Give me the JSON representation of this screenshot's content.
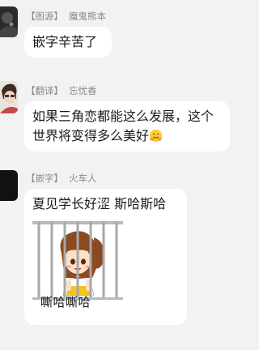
{
  "messages": [
    {
      "tag": "【图源】",
      "name": "魔鬼熊本",
      "text": "嵌字辛苦了",
      "avatar_icon": "dark-avatar-icon"
    },
    {
      "tag": "【翻译】",
      "name": "忘忧香",
      "text": "如果三角恋都能这么发展，这个世界将变得多么美好",
      "emoji": "hugging-face-emoji",
      "avatar_icon": "person-avatar-icon"
    },
    {
      "tag": "【嵌字】",
      "name": "火车人",
      "text": "夏见学长好涩 斯哈斯哈",
      "sticker_caption": "嘶哈嘶哈",
      "sticker_icon": "caged-anime-girl-sticker",
      "avatar_icon": "black-avatar-icon"
    }
  ],
  "colors": {
    "background": "#f2f2f2",
    "bubble": "#ffffff",
    "sender_text": "#888888",
    "message_text": "#1a1a1a"
  }
}
